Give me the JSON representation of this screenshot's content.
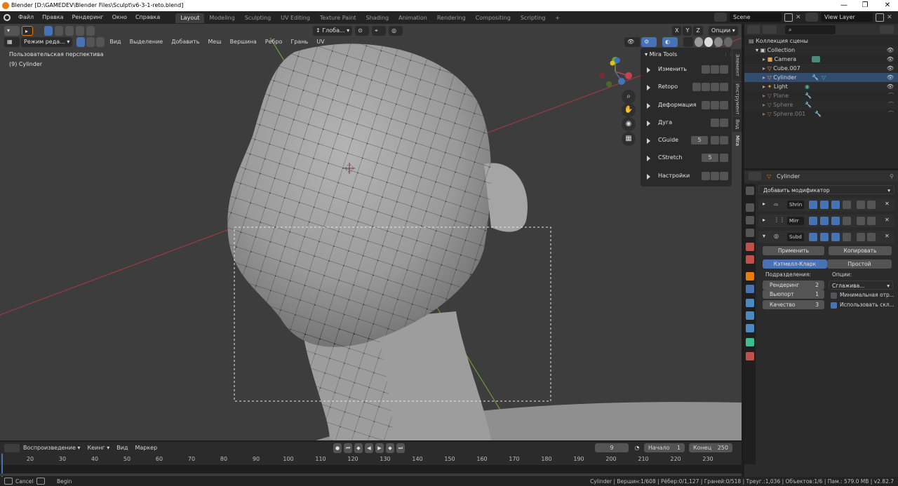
{
  "window": {
    "title": "Blender [D:\\GAMEDEV\\Blender Files\\Sculpt\\v6-3-1-reto.blend]",
    "minimize": "—",
    "maximize": "❐",
    "close": "✕"
  },
  "menu": [
    "Файл",
    "Правка",
    "Рендеринг",
    "Окно",
    "Справка"
  ],
  "workspaces": [
    "Layout",
    "Modeling",
    "Sculpting",
    "UV Editing",
    "Texture Paint",
    "Shading",
    "Animation",
    "Rendering",
    "Compositing",
    "Scripting"
  ],
  "workspace_add": "+",
  "scene": {
    "name": "Scene",
    "view_layer": "View Layer"
  },
  "viewport": {
    "orientation": "Глоба...",
    "options": "Опции",
    "axes": [
      "X",
      "Y",
      "Z"
    ],
    "mode": "Режим реда...",
    "menus": [
      "Вид",
      "Выделение",
      "Добавить",
      "Меш",
      "Вершина",
      "Ребро",
      "Грань",
      "UV"
    ],
    "perspective_label": "Пользовательская перспектива",
    "object_label": "(9) Cylinder"
  },
  "mira": {
    "title": "Mira Tools",
    "rows": [
      {
        "label": "Изменить"
      },
      {
        "label": "Retopo"
      },
      {
        "label": "Деформация"
      },
      {
        "label": "Дуга"
      },
      {
        "label": "CGuide",
        "value": "5"
      },
      {
        "label": "CStretch",
        "value": "5"
      },
      {
        "label": "Настройки"
      }
    ]
  },
  "side_tabs": [
    "Элемент",
    "Инструмент",
    "Вид",
    "Mira"
  ],
  "outliner": {
    "search_placeholder": "",
    "root": "Коллекция сцены",
    "items": [
      {
        "name": "Collection",
        "dim": false
      },
      {
        "name": "Camera",
        "dim": false
      },
      {
        "name": "Cube.007",
        "dim": false
      },
      {
        "name": "Cylinder",
        "dim": false
      },
      {
        "name": "Light",
        "dim": false
      },
      {
        "name": "Plane",
        "dim": true
      },
      {
        "name": "Sphere",
        "dim": true
      },
      {
        "name": "Sphere.001",
        "dim": true
      }
    ]
  },
  "properties": {
    "object": "Cylinder",
    "add_modifier": "Добавить модификатор",
    "modifiers": [
      "Shrin",
      "Mirr",
      "Subd"
    ],
    "apply": "Применить",
    "copy": "Копировать",
    "catmull": "Кэтмелл-Кларк",
    "simple": "Простой",
    "subdivisions_label": "Подразделения:",
    "options_label": "Опции:",
    "render": {
      "label": "Рендеринг",
      "value": "2"
    },
    "viewport_lvl": {
      "label": "Вьюпорт",
      "value": "1"
    },
    "quality": {
      "label": "Качество",
      "value": "3"
    },
    "smooth": "Сглажива...",
    "min_opt": "Минимальная отр...",
    "use_limit": "Использовать скл..."
  },
  "timeline": {
    "playback": "Воспроизведение",
    "keying": "Кеинг",
    "view": "Вид",
    "marker": "Маркер",
    "current_frame": "9",
    "start_label": "Начало",
    "start": "1",
    "end_label": "Конец",
    "end": "250",
    "ticks": [
      "20",
      "30",
      "40",
      "50",
      "60",
      "70",
      "80",
      "90",
      "100",
      "110",
      "120",
      "130",
      "140",
      "150",
      "160",
      "170",
      "180",
      "190",
      "200",
      "210",
      "220",
      "230"
    ]
  },
  "status": {
    "cancel": "Cancel",
    "begin": "Begin",
    "stats": "Cylinder | Вершин:1/608 | Рёбер:0/1,127 | Граней:0/518 | Треуг.:1,036 | Объектов:1/6 | Пам.: 579.0 MB | v2.82.7"
  },
  "colors": {
    "accent": "#4772b3",
    "viewport_bg": "#3d3d3d",
    "x_axis": "#c3434f",
    "y_axis": "#7ab33c",
    "active_outline": "#ffffff"
  }
}
